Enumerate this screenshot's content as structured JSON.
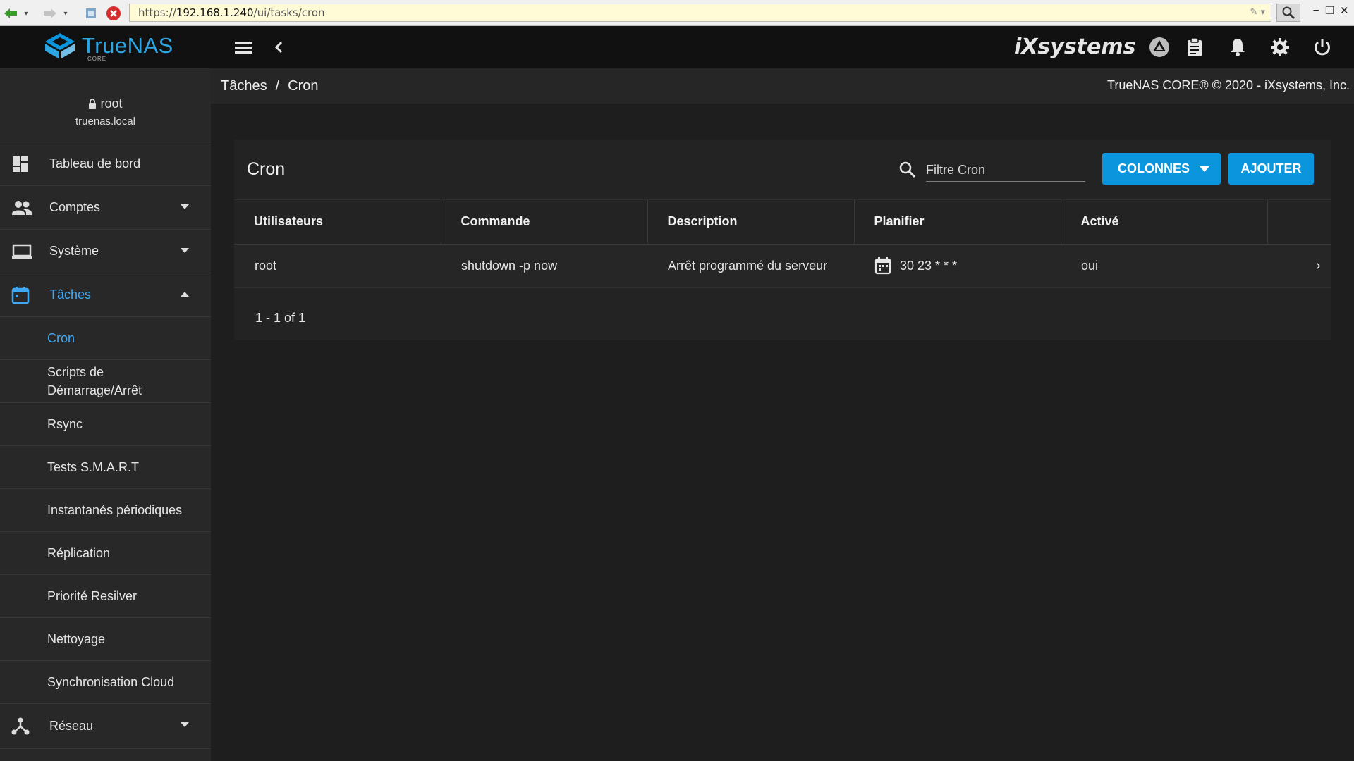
{
  "browser": {
    "url_scheme": "https://",
    "url_host": "192.168.1.240",
    "url_path": "/ui/tasks/cron"
  },
  "topbar": {
    "logo_text": "TrueNAS",
    "logo_sub": "CORE",
    "brand": "iXsystems"
  },
  "user": {
    "name": "root",
    "host": "truenas.local"
  },
  "sidebar": {
    "items": [
      {
        "label": "Tableau de bord",
        "icon": "dashboard-icon"
      },
      {
        "label": "Comptes",
        "icon": "accounts-icon"
      },
      {
        "label": "Système",
        "icon": "system-icon"
      },
      {
        "label": "Tâches",
        "icon": "tasks-calendar-icon"
      }
    ],
    "sub_items": [
      "Cron",
      "Scripts de Démarrage/Arrêt",
      "Rsync",
      "Tests S.M.A.R.T",
      "Instantanés périodiques",
      "Réplication",
      "Priorité Resilver",
      "Nettoyage",
      "Synchronisation Cloud"
    ],
    "network": {
      "label": "Réseau",
      "icon": "network-icon"
    }
  },
  "breadcrumb": {
    "parent": "Tâches",
    "sep": "/",
    "current": "Cron"
  },
  "copyright": "TrueNAS CORE® © 2020 - iXsystems, Inc.",
  "card": {
    "title": "Cron",
    "search_placeholder": "Filtre Cron",
    "columns_button": "COLONNES",
    "add_button": "AJOUTER",
    "headers": [
      "Utilisateurs",
      "Commande",
      "Description",
      "Planifier",
      "Activé"
    ],
    "rows": [
      {
        "user": "root",
        "command": "shutdown -p now",
        "description": "Arrêt programmé du serveur",
        "schedule": "30 23 * * *",
        "enabled": "oui"
      }
    ],
    "pager": "1 - 1 of 1"
  },
  "colors": {
    "accent": "#0a95dd",
    "active_link": "#3fa9f5",
    "sidebar_bg": "#282828",
    "topbar_bg": "#111111"
  }
}
